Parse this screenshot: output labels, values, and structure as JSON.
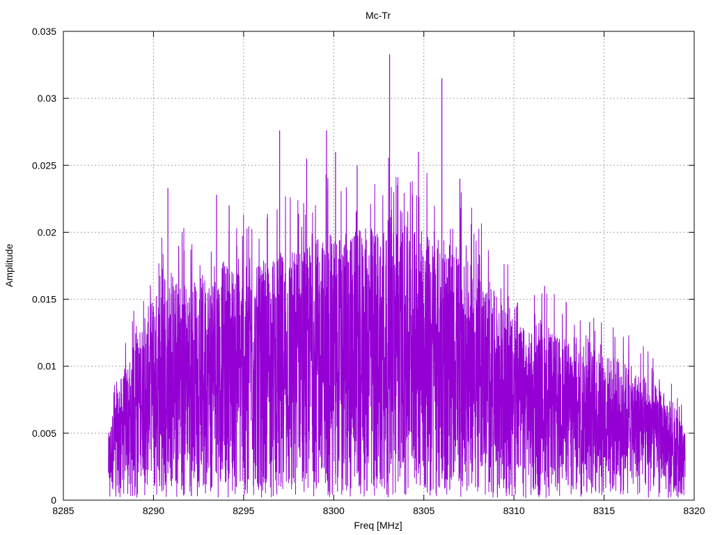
{
  "chart_data": {
    "type": "line",
    "title": "Mc-Tr",
    "xlabel": "Freq [MHz]",
    "ylabel": "Amplitude",
    "xlim": [
      8285,
      8320
    ],
    "ylim": [
      0,
      0.035
    ],
    "x_ticks": [
      8285,
      8290,
      8295,
      8300,
      8305,
      8310,
      8315,
      8320
    ],
    "x_tick_labels": [
      "8285",
      "8290",
      "8295",
      "8300",
      "8305",
      "8310",
      "8315",
      "8320"
    ],
    "y_ticks": [
      0,
      0.005,
      0.01,
      0.015,
      0.02,
      0.025,
      0.03,
      0.035
    ],
    "y_tick_labels": [
      "0",
      "0.005",
      "0.01",
      "0.015",
      "0.02",
      "0.025",
      "0.03",
      "0.035"
    ],
    "grid": true,
    "legend": "none",
    "series": [
      {
        "color": "#9400d3",
        "x_range": [
          8287.5,
          8319.5
        ],
        "envelope": {
          "x": [
            8287.5,
            8288.0,
            8289.0,
            8290.0,
            8291.0,
            8292.0,
            8293.0,
            8294.0,
            8295.0,
            8296.0,
            8297.0,
            8298.0,
            8299.0,
            8300.0,
            8301.0,
            8302.0,
            8303.0,
            8304.0,
            8305.0,
            8306.0,
            8307.0,
            8308.0,
            8309.0,
            8310.0,
            8311.0,
            8312.0,
            8313.0,
            8314.0,
            8315.0,
            8316.0,
            8317.0,
            8318.0,
            8319.0,
            8319.5
          ],
          "max": [
            0.005,
            0.0085,
            0.012,
            0.0155,
            0.0165,
            0.0165,
            0.017,
            0.018,
            0.0175,
            0.0175,
            0.0185,
            0.019,
            0.0195,
            0.02,
            0.02,
            0.0205,
            0.021,
            0.0205,
            0.02,
            0.0195,
            0.0185,
            0.017,
            0.0155,
            0.0135,
            0.0125,
            0.0125,
            0.012,
            0.0115,
            0.011,
            0.0105,
            0.0095,
            0.0085,
            0.007,
            0.005
          ],
          "min": [
            0.0005,
            0.001,
            0.0015,
            0.002,
            0.002,
            0.002,
            0.002,
            0.002,
            0.002,
            0.002,
            0.002,
            0.002,
            0.002,
            0.002,
            0.002,
            0.002,
            0.002,
            0.002,
            0.002,
            0.002,
            0.002,
            0.002,
            0.002,
            0.0015,
            0.0015,
            0.0015,
            0.0015,
            0.0015,
            0.0015,
            0.0015,
            0.0015,
            0.0015,
            0.001,
            0.001
          ]
        },
        "peaks": [
          {
            "x": 8290.8,
            "y": 0.0233
          },
          {
            "x": 8293.5,
            "y": 0.0228
          },
          {
            "x": 8294.2,
            "y": 0.022
          },
          {
            "x": 8297.0,
            "y": 0.0276
          },
          {
            "x": 8298.5,
            "y": 0.0255
          },
          {
            "x": 8299.6,
            "y": 0.0276
          },
          {
            "x": 8300.1,
            "y": 0.026
          },
          {
            "x": 8301.3,
            "y": 0.025
          },
          {
            "x": 8303.1,
            "y": 0.0333
          },
          {
            "x": 8304.7,
            "y": 0.026
          },
          {
            "x": 8306.0,
            "y": 0.0315
          },
          {
            "x": 8307.0,
            "y": 0.024
          },
          {
            "x": 8311.7,
            "y": 0.016
          },
          {
            "x": 8312.9,
            "y": 0.0148
          },
          {
            "x": 8314.2,
            "y": 0.0133
          }
        ]
      }
    ]
  }
}
